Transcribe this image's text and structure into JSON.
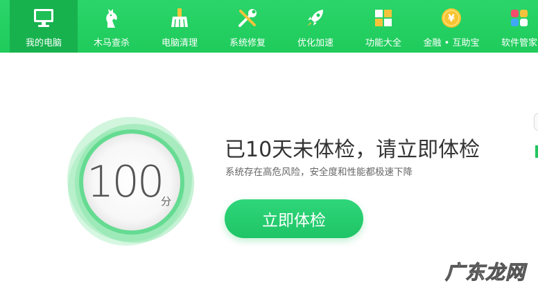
{
  "nav": {
    "items": [
      {
        "label": "我的电脑",
        "icon": "monitor-icon",
        "active": true
      },
      {
        "label": "木马查杀",
        "icon": "horse-icon",
        "active": false
      },
      {
        "label": "电脑清理",
        "icon": "broom-icon",
        "active": false
      },
      {
        "label": "系统修复",
        "icon": "wrench-screwdriver-icon",
        "active": false
      },
      {
        "label": "优化加速",
        "icon": "rocket-icon",
        "active": false
      },
      {
        "label": "功能大全",
        "icon": "grid-icon",
        "active": false
      },
      {
        "label": "金融 • 互助宝",
        "icon": "yuan-coin-icon",
        "active": false
      },
      {
        "label": "软件管家",
        "icon": "software-blocks-icon",
        "active": false
      }
    ]
  },
  "score": {
    "value": "100",
    "unit": "分"
  },
  "main": {
    "headline": "已10天未体检，请立即体检",
    "subline": "系统存在高危风险，安全度和性能都极速下降",
    "check_button": "立即体检"
  },
  "watermark": {
    "text": "广东龙网"
  },
  "colors": {
    "nav_bg": "#22cf60",
    "nav_active": "#17b24e",
    "accent_green": "#22c55e",
    "text_dark": "#333333"
  }
}
